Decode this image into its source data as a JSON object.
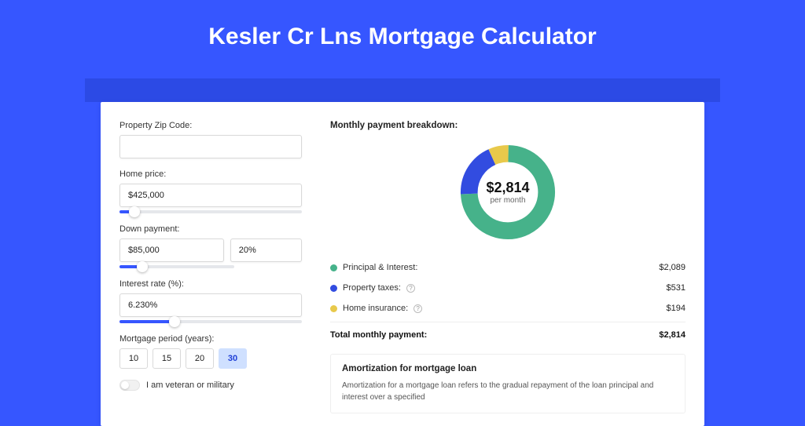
{
  "title": "Kesler Cr Lns Mortgage Calculator",
  "form": {
    "zip_label": "Property Zip Code",
    "zip_value": "",
    "home_price_label": "Home price",
    "home_price_value": "$425,000",
    "home_price_pct": "8%",
    "down_label": "Down payment",
    "down_value": "$85,000",
    "down_pct_value": "20%",
    "down_pct_slider": "20%",
    "rate_label": "Interest rate (%)",
    "rate_value": "6.230%",
    "rate_pct_slider": "30%",
    "period_label": "Mortgage period (years)",
    "periods": [
      "10",
      "15",
      "20",
      "30"
    ],
    "period_selected_index": 3,
    "veteran_label": "I am veteran or military"
  },
  "breakdown": {
    "title": "Monthly payment breakdown",
    "amount": "$2,814",
    "per": "per month",
    "items": [
      {
        "label": "Principal & Interest",
        "value": "$2,089",
        "color": "green",
        "info": false
      },
      {
        "label": "Property taxes",
        "value": "$531",
        "color": "blue",
        "info": true
      },
      {
        "label": "Home insurance",
        "value": "$194",
        "color": "yellow",
        "info": true
      }
    ],
    "total_label": "Total monthly payment",
    "total_value": "$2,814"
  },
  "amort": {
    "title": "Amortization for mortgage loan",
    "text": "Amortization for a mortgage loan refers to the gradual repayment of the loan principal and interest over a specified"
  },
  "chart_data": {
    "type": "pie",
    "title": "Monthly payment breakdown",
    "categories": [
      "Principal & Interest",
      "Property taxes",
      "Home insurance"
    ],
    "values": [
      2089,
      531,
      194
    ],
    "colors": [
      "#46b28a",
      "#324ce0",
      "#e8c94b"
    ],
    "total": 2814
  }
}
